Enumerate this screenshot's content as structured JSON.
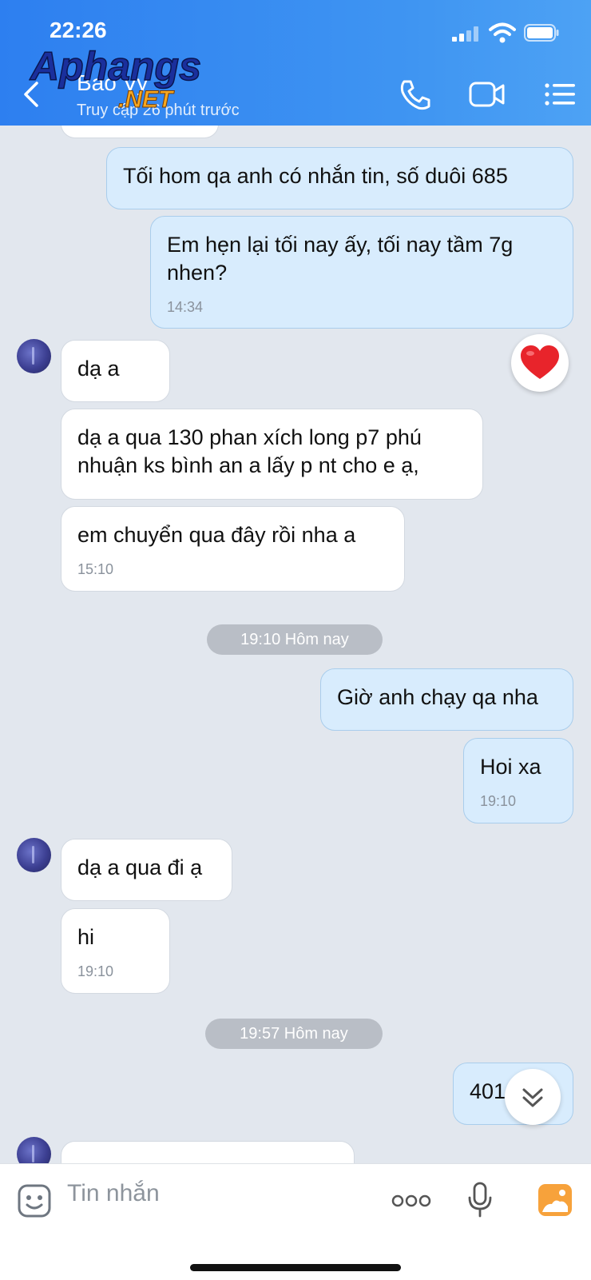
{
  "status_bar": {
    "time": "22:26"
  },
  "header": {
    "contact_name": "Bao Vy",
    "contact_status": "Truy cập 26 phút trước",
    "watermark_top": "Aphangs",
    "watermark_bottom": ".NET"
  },
  "chat": {
    "messages": [
      {
        "from": "me",
        "text": "Tối hom qa anh có nhắn tin, số duôi 685"
      },
      {
        "from": "me",
        "text": "Em hẹn lại tối nay ấy, tối nay tầm 7g nhen?",
        "time": "14:34"
      },
      {
        "from": "contact",
        "text": "dạ a",
        "reaction": "heart"
      },
      {
        "from": "contact",
        "text": "dạ a qua 130 phan xích long p7 phú nhuận ks bình an a lấy p nt cho e ạ,"
      },
      {
        "from": "contact",
        "text": "em chuyển qua đây rồi nha a",
        "time": "15:10"
      },
      {
        "from": "me",
        "text": "Giờ anh chạy qa nha"
      },
      {
        "from": "me",
        "text": "Hoi xa",
        "time": "19:10"
      },
      {
        "from": "contact",
        "text": "dạ a qua đi ạ"
      },
      {
        "from": "contact",
        "text": "hi",
        "time": "19:10"
      },
      {
        "from": "me",
        "text": "401"
      }
    ],
    "dividers": [
      "19:10 Hôm nay",
      "19:57 Hôm nay"
    ]
  },
  "composer": {
    "placeholder": "Tin nhắn"
  },
  "colors": {
    "header": "#2d7ff0",
    "chat_background": "#e2e7ee",
    "outgoing_bubble": "#d8ecfd",
    "incoming_bubble": "#ffffff",
    "accent_orange": "#f7a23b"
  },
  "icons": [
    "back-icon",
    "phone-icon",
    "video-call-icon",
    "menu-list-icon",
    "heart-icon",
    "scroll-down-icon",
    "sticker-icon",
    "more-icon",
    "microphone-icon",
    "image-icon"
  ]
}
